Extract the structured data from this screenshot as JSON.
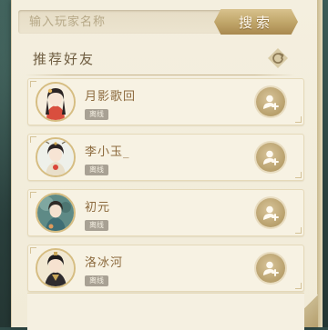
{
  "search": {
    "placeholder": "输入玩家名称",
    "button_label": "搜索"
  },
  "recommend": {
    "title": "推荐好友",
    "refresh_icon": "refresh-icon"
  },
  "friends": [
    {
      "name": "月影歌回",
      "status": "离线",
      "avatar_icon": "character-portrait-icon"
    },
    {
      "name": "李小玉_",
      "status": "离线",
      "avatar_icon": "character-portrait-icon"
    },
    {
      "name": "初元",
      "status": "离线",
      "avatar_icon": "character-portrait-icon"
    },
    {
      "name": "洛冰河",
      "status": "离线",
      "avatar_icon": "character-portrait-icon"
    }
  ],
  "colors": {
    "accent_gold": "#bfa468",
    "parchment": "#f4efdf",
    "name_text": "#8c6a3e",
    "offline_badge": "#a8a194"
  }
}
